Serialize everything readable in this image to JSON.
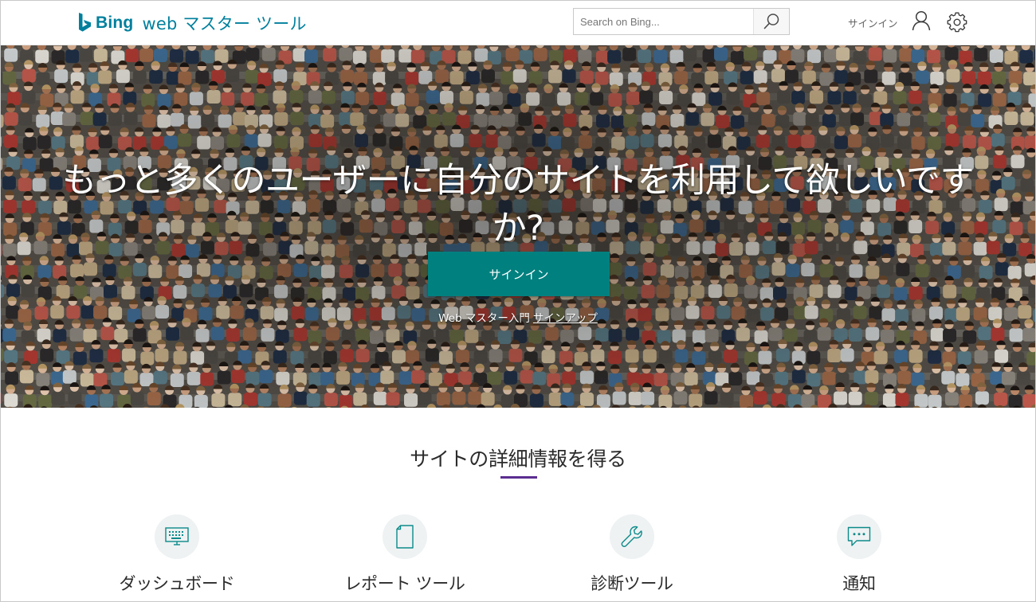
{
  "header": {
    "brand": "Bing",
    "product": "web マスター ツール",
    "search_placeholder": "Search on Bing...",
    "signin_label": "サインイン"
  },
  "hero": {
    "title": "もっと多くのユーザーに自分のサイトを利用して欲しいですか?",
    "signin_button": "サインイン",
    "intro_text": "Web マスター入門",
    "signup_link": "サインアップ"
  },
  "features": {
    "title": "サイトの詳細情報を得る",
    "items": [
      {
        "label": "ダッシュボード",
        "icon": "dashboard-icon"
      },
      {
        "label": "レポート ツール",
        "icon": "report-icon"
      },
      {
        "label": "診断ツール",
        "icon": "wrench-icon"
      },
      {
        "label": "通知",
        "icon": "chat-icon"
      }
    ]
  },
  "colors": {
    "brand_teal": "#00809d",
    "button_teal": "#00807f",
    "accent_purple": "#5c2d91",
    "icon_teal": "#0d8a8a"
  }
}
